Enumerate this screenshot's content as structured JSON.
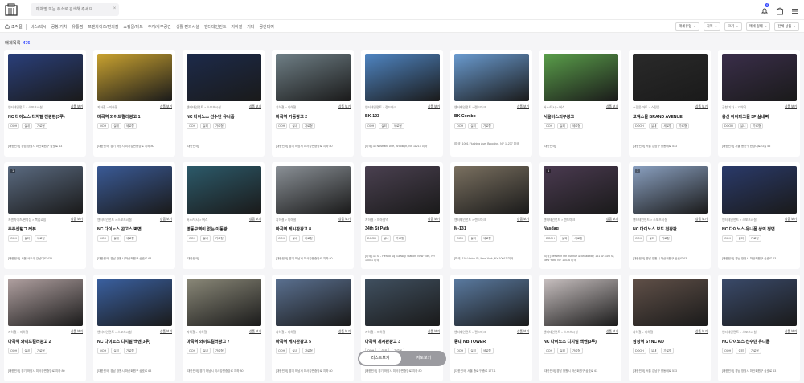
{
  "header": {
    "search_placeholder": "매체명 또는 주소로 검색해 주세요",
    "clear": "×",
    "notification_count": "4"
  },
  "nav": {
    "home": "조각몰",
    "items": [
      "버스/택시",
      "공항/기차",
      "유통점",
      "프랜차이즈/편의점",
      "쇼핑몰/마트",
      "주거/사무공간",
      "생활 편의시설",
      "엔터테인먼트",
      "지하철",
      "기타",
      "공간대여"
    ]
  },
  "filters": [
    "매체유형",
    "지역",
    "크기",
    "매체 형태",
    "전체 상품"
  ],
  "result": {
    "label": "매체목록",
    "count": "476"
  },
  "detail_label": "상품 보기",
  "cards": [
    {
      "cat": "엔터테인먼트 > 스포츠시설",
      "title": "NC 다이노스 디지털 전광판(3루)",
      "tags": [
        "OOH",
        "실내",
        "가로형"
      ],
      "addr": "[대한민국] 경남 창원시 마산회원구 삼호로 63",
      "img": "#2a3f7a",
      "count": ""
    },
    {
      "cat": "지하철 > 지하철",
      "title": "마곡역 와이드컬러광고 1",
      "tags": [
        "OOH",
        "실내",
        "세로형"
      ],
      "addr": "[대한민국] 경기 하남시 미사강변중앙로 지하 80",
      "img": "#c9a230",
      "count": ""
    },
    {
      "cat": "엔터테인먼트 > 스포츠시설",
      "title": "NC 다이노스 선수단 유니폼",
      "tags": [
        "OOH",
        "실외",
        "가로형"
      ],
      "addr": "[대한민국]",
      "img": "#1c2a4a",
      "count": ""
    },
    {
      "cat": "지하철 > 지하철",
      "title": "마곡역 기둥광고 2",
      "tags": [
        "OOH",
        "실내",
        "가로형"
      ],
      "addr": "[대한민국] 경기 하남시 미사강변중앙로 지하 80",
      "img": "#6f7f86",
      "count": ""
    },
    {
      "cat": "엔터테인먼트 > 랜드마크",
      "title": "BK-123",
      "tags": [
        "OOH",
        "실외",
        "세로형"
      ],
      "addr": "[미국] 38 Nostrand Ave, Brooklyn, NY 11216 미국",
      "img": "#4f85c2",
      "count": ""
    },
    {
      "cat": "엔터테인먼트 > 랜드마크",
      "title": "BK Combo",
      "tags": [
        "OOH",
        "실외",
        "가로형"
      ],
      "addr": "[미국] 1001 Flushing Ave, Brooklyn, NY 11237 미국",
      "img": "#6a9bd0",
      "count": "",
      "two": true
    },
    {
      "cat": "버스/택시 > 버스",
      "title": "서울버스외부광고",
      "tags": [
        "OOH",
        "실외",
        "세로형"
      ],
      "addr": "[대한민국]",
      "img": "#5a9e4a",
      "count": ""
    },
    {
      "cat": "쇼핑몰/마트 > 쇼핑몰",
      "title": "코엑스몰 BRAND AVENUE",
      "tags": [
        "DOOH",
        "실내",
        "세로형",
        "가로형"
      ],
      "addr": "[대한민국] 서울 강남구 영동대로 513",
      "img": "#2a2a2a",
      "count": ""
    },
    {
      "cat": "공항/기차 > 기차역",
      "title": "용산 아이파크몰 3F 실내벽",
      "tags": [
        "DOOH",
        "실내",
        "가로형"
      ],
      "addr": "[대한민국] 서울 용산구 한강대로23길 55",
      "img": "#3a2e4a",
      "count": ""
    },
    {
      "cat": "프랜차이즈/편의점 > 복합쇼핑",
      "title": "주주센텀그 레뷰",
      "tags": [
        "OOH",
        "실외",
        "세로형"
      ],
      "addr": "[대한민국] 서울 서초구 강남대로 435",
      "img": "#5a6a80",
      "count": "1"
    },
    {
      "cat": "엔터테인먼트 > 스포츠시설",
      "title": "NC 다이노스 곤고스 벽면",
      "tags": [
        "OOH",
        "실내",
        "세로형"
      ],
      "addr": "[대한민국] 경남 창원시 마산회원구 삼호로 63",
      "img": "#3a5a96",
      "count": ""
    },
    {
      "cat": "버스/택시 > 버스",
      "title": "명동구역이 없는 이동광",
      "tags": [
        "OOH",
        "실내",
        "가로형"
      ],
      "addr": "[대한민국]",
      "img": "#2c5a6a",
      "count": ""
    },
    {
      "cat": "지하철 > 지하철",
      "title": "마곡역 게시판광고 8",
      "tags": [
        "OOH",
        "실내",
        "가로형"
      ],
      "addr": "[대한민국] 경기 하남시 미사강변중앙로 지하 80",
      "img": "#8a9096",
      "count": ""
    },
    {
      "cat": "지하철 > 지하철역",
      "title": "34th St Path",
      "tags": [
        "DOOH",
        "실내",
        "가로형"
      ],
      "addr": "[미국] 34 St - Herald Sq Subway Station, New York, NY 10001 미국",
      "img": "#4a4050",
      "count": "",
      "two": true
    },
    {
      "cat": "엔터테인먼트 > 랜드마크",
      "title": "M-131",
      "tags": [
        "OOH",
        "실외",
        "세로형"
      ],
      "addr": "[미국] 110 Varick St, New York, NY 10013 미국",
      "img": "#7a7060",
      "count": ""
    },
    {
      "cat": "엔터테인먼트 > 랜드마크",
      "title": "Nasdaq",
      "tags": [
        "DOOH",
        "실외",
        "세로형"
      ],
      "addr": "[미국] between 6th Avenue & Broadway, 151 W 43rd St, New York, NY 10036 미국",
      "img": "#4a3a50",
      "count": "1",
      "two": true
    },
    {
      "cat": "엔터테인먼트 > 스포츠시설",
      "title": "NC 다이노스 보드 전광판",
      "tags": [
        "OOH",
        "실외",
        "가로형"
      ],
      "addr": "[대한민국] 경남 창원시 마산회원구 삼호로 63",
      "img": "#8aa0c0",
      "count": "1"
    },
    {
      "cat": "엔터테인먼트 > 스포츠시설",
      "title": "NC 다이노스 유니폼 상의 정면",
      "tags": [
        "OOH",
        "실외",
        "가로형"
      ],
      "addr": "[대한민국] 경남 창원시 마산회원구 삼호로 63",
      "img": "#2a3a6a",
      "count": ""
    },
    {
      "cat": "지하철 > 지하철",
      "title": "마곡역 와이드컬러광고 2",
      "tags": [
        "OOH",
        "실내",
        "가로형"
      ],
      "addr": "[대한민국] 경기 하남시 미사강변중앙로 지하 80",
      "img": "#b0a0a0",
      "count": ""
    },
    {
      "cat": "엔터테인먼트 > 스포츠시설",
      "title": "NC 다이노스 디지털 백엔(3루)",
      "tags": [
        "OOH",
        "실외",
        "가로형"
      ],
      "addr": "[대한민국] 경남 창원시 마산회원구 삼호로 63",
      "img": "#3a60a0",
      "count": ""
    },
    {
      "cat": "지하철 > 지하철",
      "title": "마곡역 와이드컬러광고 7",
      "tags": [
        "OOH",
        "실내",
        "가로형"
      ],
      "addr": "[대한민국] 경기 하남시 미사강변중앙로 지하 80",
      "img": "#8a8878",
      "count": ""
    },
    {
      "cat": "지하철 > 지하철",
      "title": "마곡역 게시판광고 5",
      "tags": [
        "OOH",
        "실내",
        "가로형"
      ],
      "addr": "[대한민국] 경기 하남시 미사강변중앙로 지하 80",
      "img": "#5a7090",
      "count": ""
    },
    {
      "cat": "지하철 > 지하철",
      "title": "마곡역 게시판광고 3",
      "tags": [
        "OOH",
        "실내",
        "가로형"
      ],
      "addr": "[대한민국] 경기 하남시 미사강변중앙로 지하 80",
      "img": "#405060",
      "count": ""
    },
    {
      "cat": "엔터테인먼트 > 랜드마크",
      "title": "종대 NB TOWER",
      "tags": [
        "OOH",
        "실외",
        "세로형"
      ],
      "addr": "[대한민국] 서울 종로구 종로 177-1",
      "img": "#5a7aa0",
      "count": ""
    },
    {
      "cat": "엔터테인먼트 > 스포츠시설",
      "title": "NC 다이노스 디지털 백엔(3루)",
      "tags": [
        "OOH",
        "실외",
        "가로형"
      ],
      "addr": "[대한민국] 경남 창원시 마산회원구 삼호로 63",
      "img": "#c8c0c0",
      "count": ""
    },
    {
      "cat": "지하철 > 지하철",
      "title": "삼성역 SYNC AD",
      "tags": [
        "DOOH",
        "실내",
        "가로형"
      ],
      "addr": "[대한민국] 서울 강남구 영동대로 513",
      "img": "#605048",
      "count": ""
    },
    {
      "cat": "엔터테인먼트 > 스포츠시설",
      "title": "NC 다이노스 선수단 유니폼",
      "tags": [
        "OOH",
        "실외",
        "가로형"
      ],
      "addr": "[대한민국] 경남 창원시 마산회원구 삼호로 63",
      "img": "#3a4a6a",
      "count": ""
    }
  ],
  "view_toggle": {
    "list": "리스트보기",
    "map": "지도보기"
  },
  "colors": {
    "accent": "#3347ff",
    "bg": "#f5f5f7"
  }
}
